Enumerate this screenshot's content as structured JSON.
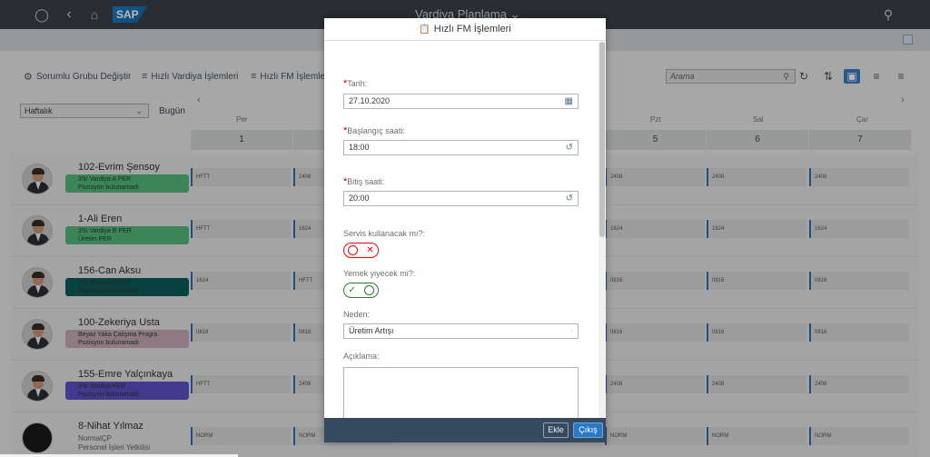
{
  "shell": {
    "title": "Vardiya Planlama",
    "logo": "SAP",
    "icons": [
      "user-icon",
      "back-icon",
      "home-icon",
      "search-icon"
    ]
  },
  "toolbar": {
    "change_group": "Sorumlu Grubu Değiştir",
    "quick_shift": "Hızlı Vardiya İşlemleri",
    "quick_fm": "Hızlı FM İşlemleri",
    "search_placeholder": "Arama"
  },
  "calendar": {
    "period": "Haftalık",
    "today": "Bugün",
    "days": [
      {
        "name": "Per",
        "num": "1"
      },
      {
        "name": "Pzt",
        "num": "5"
      },
      {
        "name": "Sal",
        "num": "6"
      },
      {
        "name": "Çar",
        "num": "7"
      }
    ]
  },
  "employees": [
    {
      "name": "102-Evrim Şensoy",
      "tag1": "3'lü Vardiya A PER",
      "tag2": "Pozisyon bulunamadı",
      "tag_color": "#53b97a",
      "shifts": [
        "HFTT",
        "2408",
        "2408",
        "2408",
        "2408"
      ]
    },
    {
      "name": "1-Ali Eren",
      "tag1": "3'lü Vardiya B PER",
      "tag2": "Üretim PER",
      "tag_color": "#53b97a",
      "shifts": [
        "HFTT",
        "1624",
        "1624",
        "1624",
        "1624"
      ]
    },
    {
      "name": "156-Can Aksu",
      "tag1": "3'lü Vardiya C PER",
      "tag2": "Pozisyon bulunamadı",
      "tag_color": "#0e5a5a",
      "shifts": [
        "1624",
        "HFTT",
        "0816",
        "0816",
        "0816"
      ]
    },
    {
      "name": "100-Zekeriya Usta",
      "tag1": "Beyaz Yaka Çalışma Progra",
      "tag2": "Pozisyon bulunamadı",
      "tag_color": "#c6a9b8",
      "shifts": [
        "0816",
        "0816",
        "0816",
        "0816",
        "0816"
      ]
    },
    {
      "name": "155-Emre Yalçınkaya",
      "tag1": "3'lü Vardiya PER",
      "tag2": "Pozisyon bulunamadı",
      "tag_color": "#5b4fc4",
      "shifts": [
        "HFTT",
        "2408",
        "2408",
        "2408",
        "2408"
      ]
    },
    {
      "name": "8-Nihat Yılmaz",
      "tag1": "NormalÇP",
      "tag2": "Personel İşleri Yetkilisi",
      "tag_color": "",
      "shifts": [
        "NORM",
        "NORM",
        "NORM",
        "NORM",
        "NORM"
      ]
    }
  ],
  "dialog": {
    "title": "Hızlı FM İşlemleri",
    "date_label": "Tarih:",
    "date_value": "27.10.2020",
    "start_label": "Başlangıç saati:",
    "start_value": "18:00",
    "end_label": "Bitiş saati:",
    "end_value": "20:00",
    "service_label": "Servis kullanacak mı?:",
    "service_on": false,
    "meal_label": "Yemek yiyecek mi?:",
    "meal_on": true,
    "reason_label": "Neden:",
    "reason_value": "Üretim Artışı",
    "desc_label": "Açıklama:",
    "add_label": "Ekle",
    "exit_label": "Çıkış"
  }
}
